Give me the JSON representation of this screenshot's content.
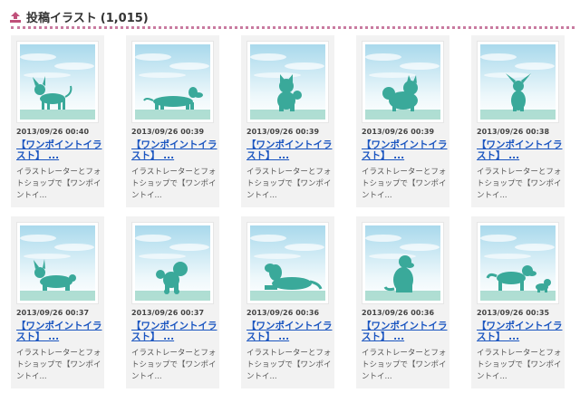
{
  "header": {
    "title": "投稿イラスト",
    "count": "(1,015)",
    "icon": "upload-icon"
  },
  "colors": {
    "divider": "#c97ba0",
    "link": "#1a55c0",
    "silhouette": "#3aa99a",
    "sky": "#a9d9ec",
    "grass": "#8fd0c0"
  },
  "posts": [
    {
      "date": "2013/09/26 00:40",
      "title": "【ワンポイントイラスト】 ...",
      "desc": "イラストレーターとフォトショップで【ワンポイントイ...",
      "subject": "chihuahua"
    },
    {
      "date": "2013/09/26 00:39",
      "title": "【ワンポイントイラスト】 ...",
      "desc": "イラストレーターとフォトショップで【ワンポイントイ...",
      "subject": "dachshund"
    },
    {
      "date": "2013/09/26 00:39",
      "title": "【ワンポイントイラスト】 ...",
      "desc": "イラストレーターとフォトショップで【ワンポイントイ...",
      "subject": "shiba"
    },
    {
      "date": "2013/09/26 00:39",
      "title": "【ワンポイントイラスト】 ...",
      "desc": "イラストレーターとフォトショップで【ワンポイントイ...",
      "subject": "pomeranian"
    },
    {
      "date": "2013/09/26 00:38",
      "title": "【ワンポイントイラスト】 ...",
      "desc": "イラストレーターとフォトショップで【ワンポイントイ...",
      "subject": "papillon"
    },
    {
      "date": "2013/09/26 00:37",
      "title": "【ワンポイントイラスト】 ...",
      "desc": "イラストレーターとフォトショップで【ワンポイントイ...",
      "subject": "corgi"
    },
    {
      "date": "2013/09/26 00:37",
      "title": "【ワンポイントイラスト】 ...",
      "desc": "イラストレーターとフォトショップで【ワンポイントイ...",
      "subject": "poodle"
    },
    {
      "date": "2013/09/26 00:36",
      "title": "【ワンポイントイラスト】 ...",
      "desc": "イラストレーターとフォトショップで【ワンポイントイ...",
      "subject": "retriever-lying"
    },
    {
      "date": "2013/09/26 00:36",
      "title": "【ワンポイントイラスト】 ...",
      "desc": "イラストレーターとフォトショップで【ワンポイントイ...",
      "subject": "retriever-sitting"
    },
    {
      "date": "2013/09/26 00:35",
      "title": "【ワンポイントイラスト】 ...",
      "desc": "イラストレーターとフォトショップで【ワンポイントイ...",
      "subject": "retriever-and-puppy"
    }
  ]
}
